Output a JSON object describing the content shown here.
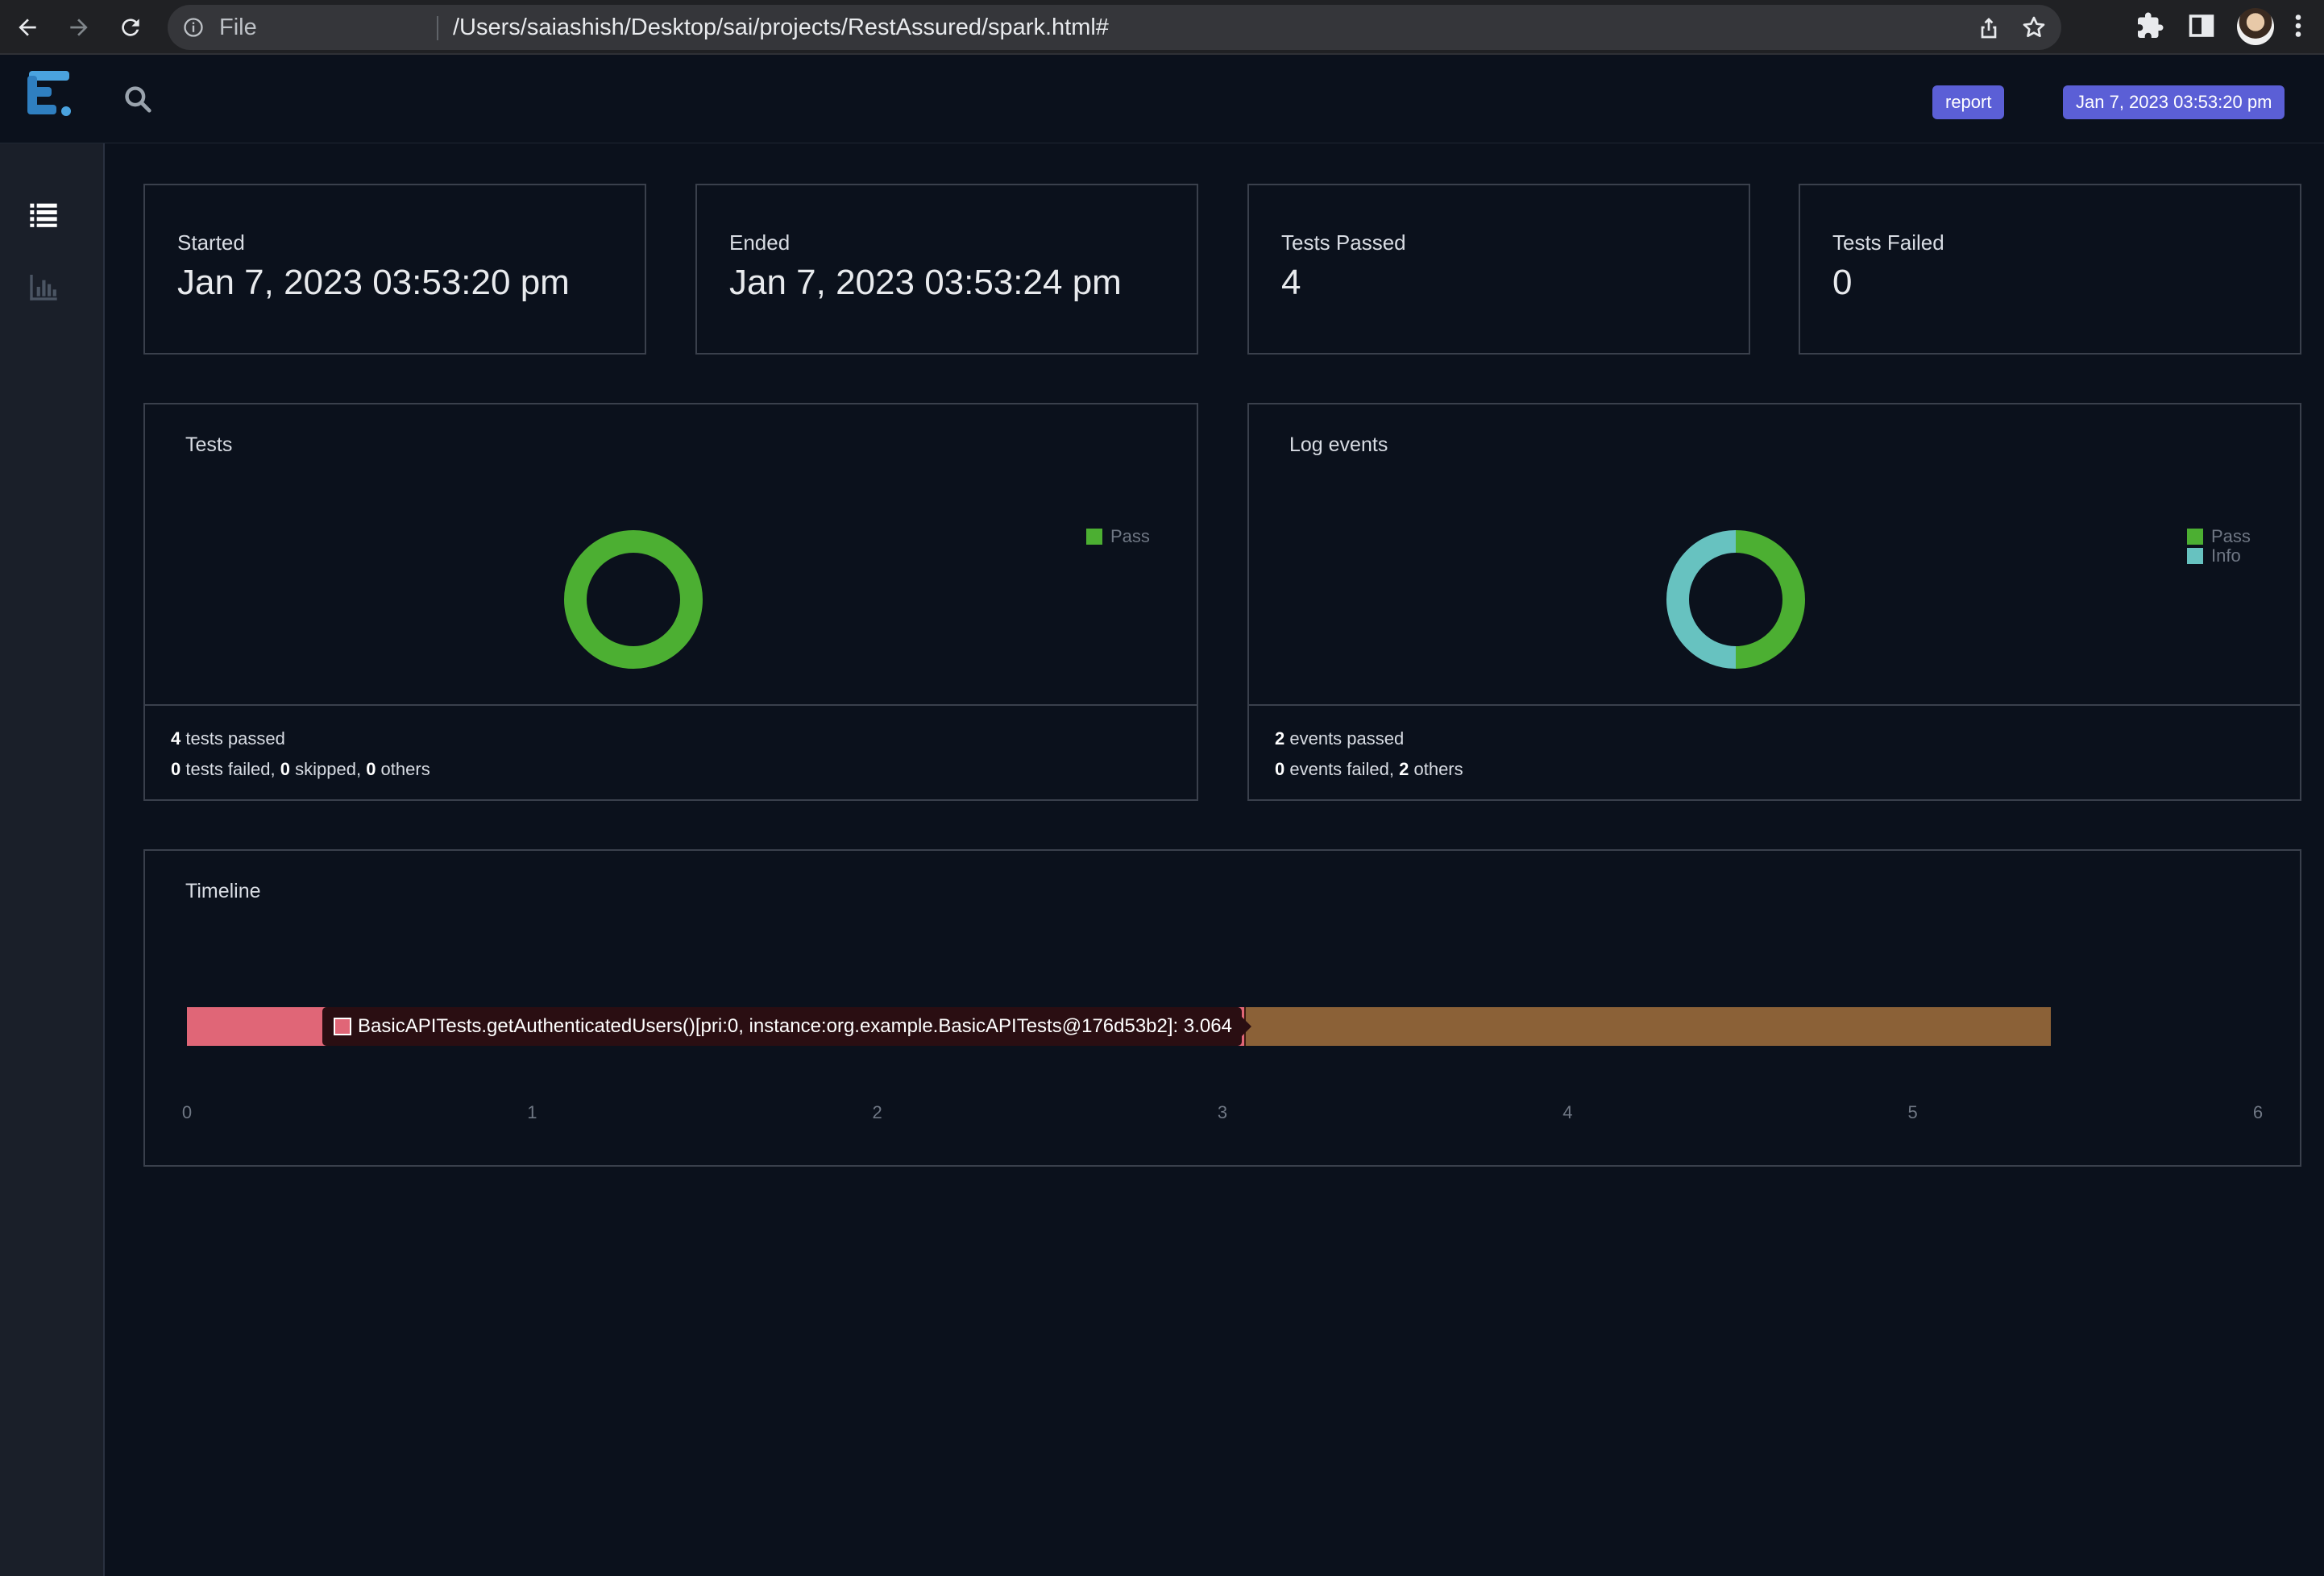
{
  "browser": {
    "scheme_label": "File",
    "url": "/Users/saiashish/Desktop/sai/projects/RestAssured/spark.html#"
  },
  "header": {
    "report_badge": "report",
    "date_badge": "Jan 7, 2023 03:53:20 pm"
  },
  "stats": [
    {
      "label": "Started",
      "value": "Jan 7, 2023 03:53:20 pm"
    },
    {
      "label": "Ended",
      "value": "Jan 7, 2023 03:53:24 pm"
    },
    {
      "label": "Tests Passed",
      "value": "4"
    },
    {
      "label": "Tests Failed",
      "value": "0"
    }
  ],
  "tests_panel": {
    "title": "Tests",
    "legend": [
      {
        "label": "Pass",
        "color": "#4caf32"
      }
    ],
    "slices": [
      {
        "label": "Pass",
        "value": 4,
        "color": "#4caf32"
      }
    ],
    "footer": {
      "passed_count": "4",
      "passed_text": " tests passed",
      "failed_count": "0",
      "failed_text": " tests failed, ",
      "skipped_count": "0",
      "skipped_text": " skipped, ",
      "others_count": "0",
      "others_text": " others"
    }
  },
  "log_panel": {
    "title": "Log events",
    "legend": [
      {
        "label": "Pass",
        "color": "#4caf32"
      },
      {
        "label": "Info",
        "color": "#67c2c0"
      }
    ],
    "slices": [
      {
        "label": "Pass",
        "value": 2,
        "color": "#4caf32"
      },
      {
        "label": "Info",
        "value": 2,
        "color": "#67c2c0"
      }
    ],
    "footer": {
      "passed_count": "2",
      "passed_text": " events passed",
      "failed_count": "0",
      "failed_text": " events failed, ",
      "others_count": "2",
      "others_text": " others"
    }
  },
  "timeline": {
    "title": "Timeline",
    "ticks": [
      "0",
      "1",
      "2",
      "3",
      "4",
      "5",
      "6"
    ],
    "x_range": [
      0,
      6
    ],
    "segments": [
      {
        "start": 0,
        "end": 3.064,
        "color": "#e06677"
      },
      {
        "start": 3.064,
        "end": 5.4,
        "color": "#8b6137"
      }
    ],
    "tooltip": "BasicAPITests.getAuthenticatedUsers()[pri:0, instance:org.example.BasicAPITests@176d53b2]: 3.064"
  }
}
